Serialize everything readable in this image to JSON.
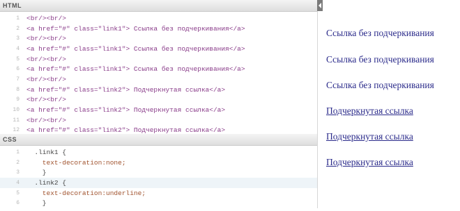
{
  "editor": {
    "html_panel_title": "HTML",
    "css_panel_title": "CSS",
    "html_lines": [
      {
        "num": "1",
        "text": "<br/><br/>"
      },
      {
        "num": "2",
        "text": "<a href=\"#\" class=\"link1\"> Ссылка без подчеркивания</a>"
      },
      {
        "num": "3",
        "text": "<br/><br/>"
      },
      {
        "num": "4",
        "text": "<a href=\"#\" class=\"link1\"> Ссылка без подчеркивания</a>"
      },
      {
        "num": "5",
        "text": "<br/><br/>"
      },
      {
        "num": "6",
        "text": "<a href=\"#\" class=\"link1\"> Ссылка без подчеркивания</a>"
      },
      {
        "num": "7",
        "text": "<br/><br/>"
      },
      {
        "num": "8",
        "text": "<a href=\"#\" class=\"link2\"> Подчеркнутая ссылка</a>"
      },
      {
        "num": "9",
        "text": "<br/><br/>"
      },
      {
        "num": "10",
        "text": "<a href=\"#\" class=\"link2\"> Подчеркнутая ссылка</a>"
      },
      {
        "num": "11",
        "text": "<br/><br/>"
      },
      {
        "num": "12",
        "text": "<a href=\"#\" class=\"link2\"> Подчеркнутая ссылка</a>"
      }
    ],
    "css_lines": [
      {
        "num": "1",
        "text": "  .link1 {"
      },
      {
        "num": "2",
        "text": "    text-decoration:none;"
      },
      {
        "num": "3",
        "text": "    }"
      },
      {
        "num": "4",
        "text": "  .link2 {"
      },
      {
        "num": "5",
        "text": "    text-decoration:underline;"
      },
      {
        "num": "6",
        "text": "    }"
      }
    ]
  },
  "result": {
    "links": [
      {
        "text": "Ссылка без подчеркивания",
        "underlined": false
      },
      {
        "text": "Ссылка без подчеркивания",
        "underlined": false
      },
      {
        "text": "Ссылка без подчеркивания",
        "underlined": false
      },
      {
        "text": "Подчеркнутая ссылка",
        "underlined": true
      },
      {
        "text": "Подчеркнутая ссылка",
        "underlined": true
      },
      {
        "text": "Подчеркнутая ссылка",
        "underlined": true
      }
    ]
  },
  "colors": {
    "link": "#2a2a8a",
    "active_line": "#eef4f8"
  }
}
